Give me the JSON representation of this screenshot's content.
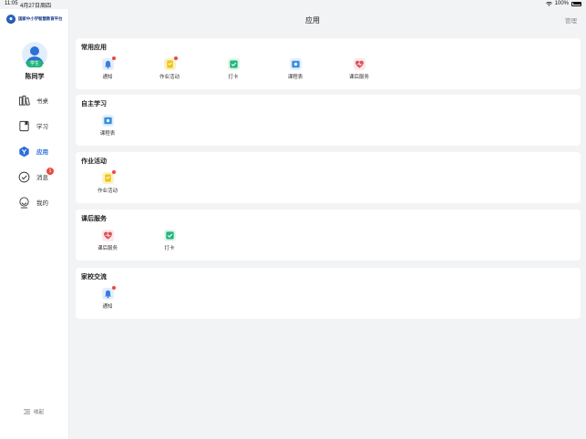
{
  "status_bar": {
    "time": "11:05",
    "date": "4月27日周四",
    "battery": "100%"
  },
  "brand": {
    "name": "国家中小学智慧教育平台"
  },
  "user": {
    "role": "学生",
    "name": "陈同学"
  },
  "nav": [
    {
      "label": "书桌",
      "icon": "desk-icon"
    },
    {
      "label": "学习",
      "icon": "study-icon"
    },
    {
      "label": "应用",
      "icon": "apps-icon",
      "active": true
    },
    {
      "label": "消息",
      "icon": "message-icon",
      "badge": "1"
    },
    {
      "label": "我的",
      "icon": "profile-icon"
    }
  ],
  "collapse_label": "收起",
  "header": {
    "title": "应用",
    "manage": "管理"
  },
  "sections": [
    {
      "title": "常用应用",
      "apps": [
        {
          "label": "通知",
          "icon": "bell-icon",
          "dot": true
        },
        {
          "label": "作业活动",
          "icon": "homework-icon",
          "dot": true
        },
        {
          "label": "打卡",
          "icon": "checkin-icon"
        },
        {
          "label": "课程表",
          "icon": "schedule-icon"
        },
        {
          "label": "课后服务",
          "icon": "after-school-icon"
        }
      ]
    },
    {
      "title": "自主学习",
      "apps": [
        {
          "label": "课程表",
          "icon": "schedule-icon"
        }
      ]
    },
    {
      "title": "作业活动",
      "apps": [
        {
          "label": "作业活动",
          "icon": "homework-icon",
          "dot": true
        }
      ]
    },
    {
      "title": "课后服务",
      "apps": [
        {
          "label": "课后服务",
          "icon": "after-school-icon"
        },
        {
          "label": "打卡",
          "icon": "checkin-icon"
        }
      ]
    },
    {
      "title": "家校交流",
      "apps": [
        {
          "label": "通知",
          "icon": "bell-icon",
          "dot": true
        }
      ]
    }
  ],
  "colors": {
    "accent": "#2c6fd8",
    "badge": "#e84a3f",
    "role_badge": "#1fb57a",
    "background": "#f2f3f5"
  }
}
